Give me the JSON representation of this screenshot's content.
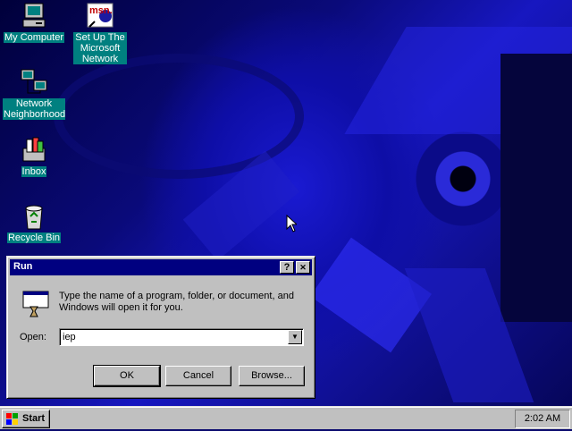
{
  "desktop": {
    "icons": [
      {
        "label": "My Computer",
        "icon": "my-computer-icon",
        "selected": true
      },
      {
        "label": "Set Up The Microsoft Network",
        "icon": "msn-icon",
        "selected": true
      },
      {
        "label": "Network Neighborhood",
        "icon": "network-neighborhood-icon",
        "selected": true
      },
      {
        "label": "Inbox",
        "icon": "inbox-icon",
        "selected": true
      },
      {
        "label": "Recycle Bin",
        "icon": "recycle-bin-icon",
        "selected": true
      }
    ],
    "msn_badge": "msn."
  },
  "run_dialog": {
    "title": "Run",
    "help_label": "?",
    "close_label": "✕",
    "description": "Type the name of a program, folder, or document, and Windows will open it for you.",
    "open_label": "Open:",
    "open_value": "iep",
    "ok_label": "OK",
    "cancel_label": "Cancel",
    "browse_label": "Browse..."
  },
  "taskbar": {
    "start_label": "Start",
    "clock": "2:02 AM"
  },
  "colors": {
    "titlebar": "#000080",
    "selection": "#008080",
    "face": "#c0c0c0"
  }
}
